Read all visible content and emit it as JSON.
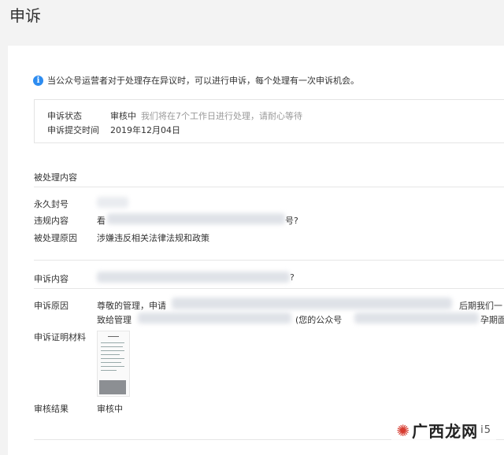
{
  "header": {
    "title": "申诉"
  },
  "notice": {
    "icon": "info-icon",
    "text": "当公众号运营者对于处理存在异议时，可以进行申诉，每个处理有一次申诉机会。"
  },
  "status": {
    "state_label": "申诉状态",
    "state_value": "审核中",
    "state_hint": "我们将在7个工作日进行处理，请耐心等待",
    "submit_label": "申诉提交时间",
    "submit_value": "2019年12月04日"
  },
  "punished": {
    "section_title": "被处理内容",
    "ban_label": "永久封号",
    "violation_label": "违规内容",
    "violation_value_start": "看",
    "violation_value_end": "号?",
    "reason_label": "被处理原因",
    "reason_value": "涉嫌违反相关法律法规和政策"
  },
  "appeal": {
    "content_label": "申诉内容",
    "content_value_end": "?",
    "reason_label": "申诉原因",
    "reason_line1_start": "尊敬的管理，申请",
    "reason_line1_end": "后期我们一",
    "reason_line2_start": "致给管理",
    "reason_line2_mid": "(您的公众号",
    "reason_line2_end": "孕期面",
    "proof_label": "申诉证明材料",
    "result_label": "审核结果",
    "result_value": "审核中"
  },
  "watermark": {
    "text": "广西龙网",
    "domain": "i5"
  }
}
